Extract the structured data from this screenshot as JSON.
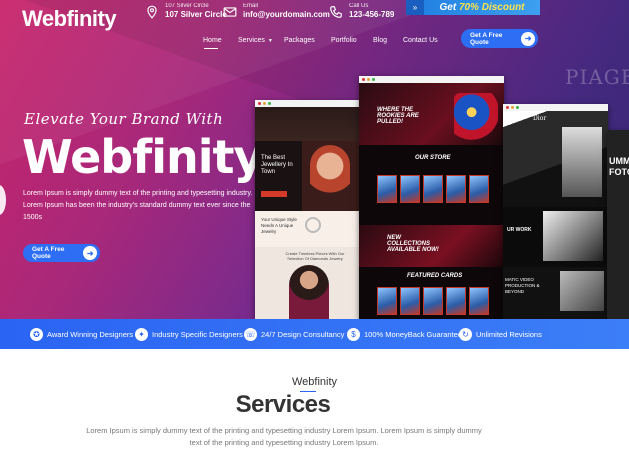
{
  "brand": {
    "logo": "Webfinity"
  },
  "topbar": {
    "address_small": "107 Silver Circle",
    "address_big": "107 Silver Circle",
    "email_small": "Email",
    "email_big": "info@yourdomain.com",
    "phone_small": "Call Us",
    "phone_big": "123-456-789",
    "discount_prefix": "Get ",
    "discount_highlight": "70% Discount"
  },
  "nav": {
    "items": [
      {
        "label": "Home",
        "active": true
      },
      {
        "label": "Services",
        "dropdown": true
      },
      {
        "label": "Packages"
      },
      {
        "label": "Portfolio"
      },
      {
        "label": "Blog"
      },
      {
        "label": "Contact Us"
      }
    ],
    "cta": "Get A Free Quote"
  },
  "hero": {
    "tagline": "Elevate Your Brand With",
    "title": "Webfinity.",
    "description": "Lorem Ipsum is simply dummy text of the printing and typesetting industry. Lorem Ipsum has been the industry's standard dummy text ever since the 1500s",
    "cta": "Get A Free Quote",
    "ghost_text": "PIAGET"
  },
  "mockups": {
    "jewelry": {
      "heading": "The Best Jewellery In Town",
      "sub": "Your Unique Style Needs A Unique Jewelry",
      "footer": "Create Timeless Pieces With Our Selection Of Diamonds Jewelry"
    },
    "cards_store": {
      "hero": "WHERE THE ROOKIES ARE PULLED!",
      "store": "OUR STORE",
      "new": "NEW COLLECTIONS AVAILABLE NOW!",
      "featured": "FEATURED CARDS"
    },
    "dior": {
      "brand": "Dior",
      "work": "UR WORK",
      "video": "MATIC VIDEO PRODUCTION & BEYOND"
    },
    "edge": {
      "text": "UMM FOTO"
    }
  },
  "features": [
    {
      "icon": "award-icon",
      "label": "Award Winning Designers"
    },
    {
      "icon": "industry-icon",
      "label": "Industry Specific Designers"
    },
    {
      "icon": "support-icon",
      "label": "24/7 Design Consultancy"
    },
    {
      "icon": "money-icon",
      "label": "100% MoneyBack Guarantee"
    },
    {
      "icon": "revision-icon",
      "label": "Unlimited Revisions"
    }
  ],
  "services": {
    "kicker": "Webfinity",
    "title": "Services",
    "description": "Lorem Ipsum is simply dummy text of the printing and typesetting industry Lorem Ipsum. Lorem Ipsum is simply dummy text of the printing and typesetting industry Lorem Ipsum."
  },
  "colors": {
    "accent_blue": "#2d6ef5",
    "hero_start": "#c8246a",
    "hero_end": "#3a2a7a",
    "discount_yellow": "#ffe24a"
  }
}
